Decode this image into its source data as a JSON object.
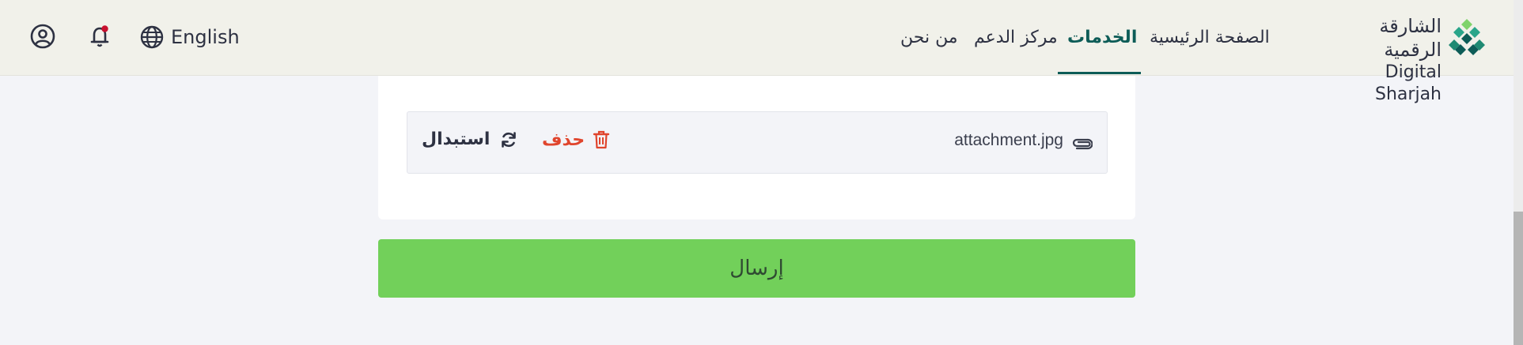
{
  "header": {
    "language_label": "English",
    "nav": {
      "home": "الصفحة الرئيسية",
      "services": "الخدمات",
      "support": "مركز الدعم",
      "about": "من نحن"
    },
    "brand": {
      "arabic": "الشارقة الرقمية",
      "english": "Digital Sharjah"
    },
    "notification_dot": true
  },
  "attachment": {
    "file_name": "attachment.jpg",
    "delete_label": "حذف",
    "replace_label": "استبدال"
  },
  "submit_label": "إرسال",
  "colors": {
    "accent": "#0d5c57",
    "delete": "#e0452d",
    "submit_bg": "#72d05a",
    "header_bg": "#f1f1ea"
  }
}
